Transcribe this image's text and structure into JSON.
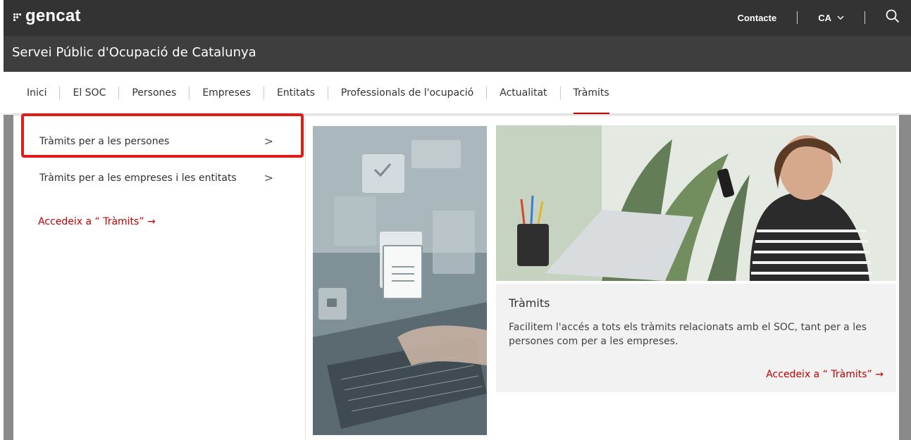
{
  "header": {
    "brand": "gencat",
    "contact_label": "Contacte",
    "language_label": "CA",
    "site_title": "Servei Públic d'Ocupació de Catalunya"
  },
  "nav": {
    "items": [
      {
        "label": "Inici"
      },
      {
        "label": "El SOC"
      },
      {
        "label": "Persones"
      },
      {
        "label": "Empreses"
      },
      {
        "label": "Entitats"
      },
      {
        "label": "Professionals de l'ocupació"
      },
      {
        "label": "Actualitat"
      },
      {
        "label": "Tràmits"
      }
    ],
    "active": "Tràmits"
  },
  "dropdown": {
    "menu_items": [
      {
        "label": "Tràmits per a les persones",
        "chevron": ">"
      },
      {
        "label": "Tràmits per a les empreses i les entitats",
        "chevron": ">"
      }
    ],
    "access_link": "Accedeix a “ Tràmits” →"
  },
  "card": {
    "title": "Tràmits",
    "description": "Facilitem l'accés a tots els tràmits relacionats amb el SOC, tant per a les persones com per a les empreses.",
    "link": "Accedeix a “ Tràmits” →"
  },
  "colors": {
    "topbar": "#333333",
    "sitebar": "#3e3e3e",
    "accent": "#c00000",
    "highlight": "#e21b1b",
    "card_bg": "#f2f2f2"
  },
  "icons": {
    "search": "search-icon",
    "language_dropdown": "chevron-down-icon",
    "menu_chevron": "chevron-right-icon"
  }
}
